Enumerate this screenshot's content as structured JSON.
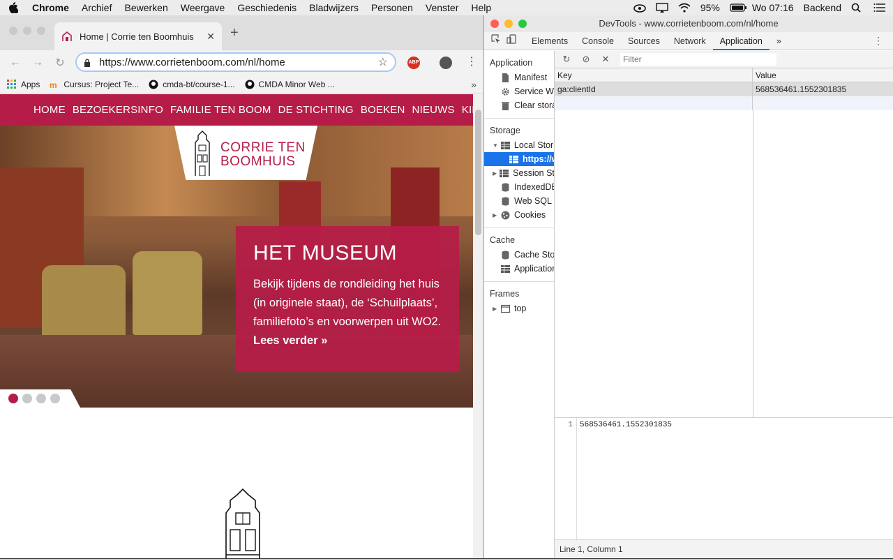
{
  "menubar": {
    "items": [
      "Chrome",
      "Archief",
      "Bewerken",
      "Weergave",
      "Geschiedenis",
      "Bladwijzers",
      "Personen",
      "Venster",
      "Help"
    ],
    "battery": "95%",
    "clock": "Wo 07:16",
    "user": "Backend"
  },
  "browser": {
    "tab_title": "Home | Corrie ten Boomhuis",
    "tab_close": "✕",
    "new_tab": "+",
    "url": "https://www.corrietenboom.com/nl/home",
    "abp_label": "ABP",
    "bookmarks": [
      {
        "label": "Apps"
      },
      {
        "label": "Cursus: Project Te..."
      },
      {
        "label": "cmda-bt/course-1..."
      },
      {
        "label": "CMDA Minor Web ..."
      }
    ],
    "bookmarks_more": "»"
  },
  "site": {
    "nav": [
      "HOME",
      "BEZOEKERSINFO",
      "FAMILIE TEN BOOM",
      "DE STICHTING",
      "BOEKEN",
      "NIEUWS",
      "KIDS"
    ],
    "logo_line1": "CORRIE TEN",
    "logo_line2": "BOOMHUIS",
    "hero_title": "HET MUSEUM",
    "hero_text": "Bekijk tijdens de rondleiding het huis (in originele staat), de ‘Schuilplaats’, familiefoto’s en voorwerpen uit WO2.",
    "hero_more": "Lees verder »",
    "slider_dots": 4,
    "slider_active": 0,
    "accent": "#b51d48"
  },
  "devtools": {
    "title": "DevTools - www.corrietenboom.com/nl/home",
    "tabs": [
      "Elements",
      "Console",
      "Sources",
      "Network",
      "Application"
    ],
    "active_tab": "Application",
    "more_tabs": "»",
    "sidebar": {
      "application_header": "Application",
      "application_items": [
        "Manifest",
        "Service Wo",
        "Clear stora"
      ],
      "storage_header": "Storage",
      "local_storage": "Local Stora",
      "local_storage_origin": "https://w",
      "session_storage": "Session St",
      "indexeddb": "IndexedDB",
      "websql": "Web SQL",
      "cookies": "Cookies",
      "cache_header": "Cache",
      "cache_items": [
        "Cache Sto",
        "Application"
      ],
      "frames_header": "Frames",
      "frames_top": "top"
    },
    "filter_placeholder": "Filter",
    "table": {
      "col_key": "Key",
      "col_value": "Value",
      "rows": [
        {
          "key": "ga:clientId",
          "value": "568536461.1552301835"
        }
      ]
    },
    "preview": {
      "line_number": "1",
      "code": "568536461.1552301835"
    },
    "status": "Line 1, Column 1"
  }
}
